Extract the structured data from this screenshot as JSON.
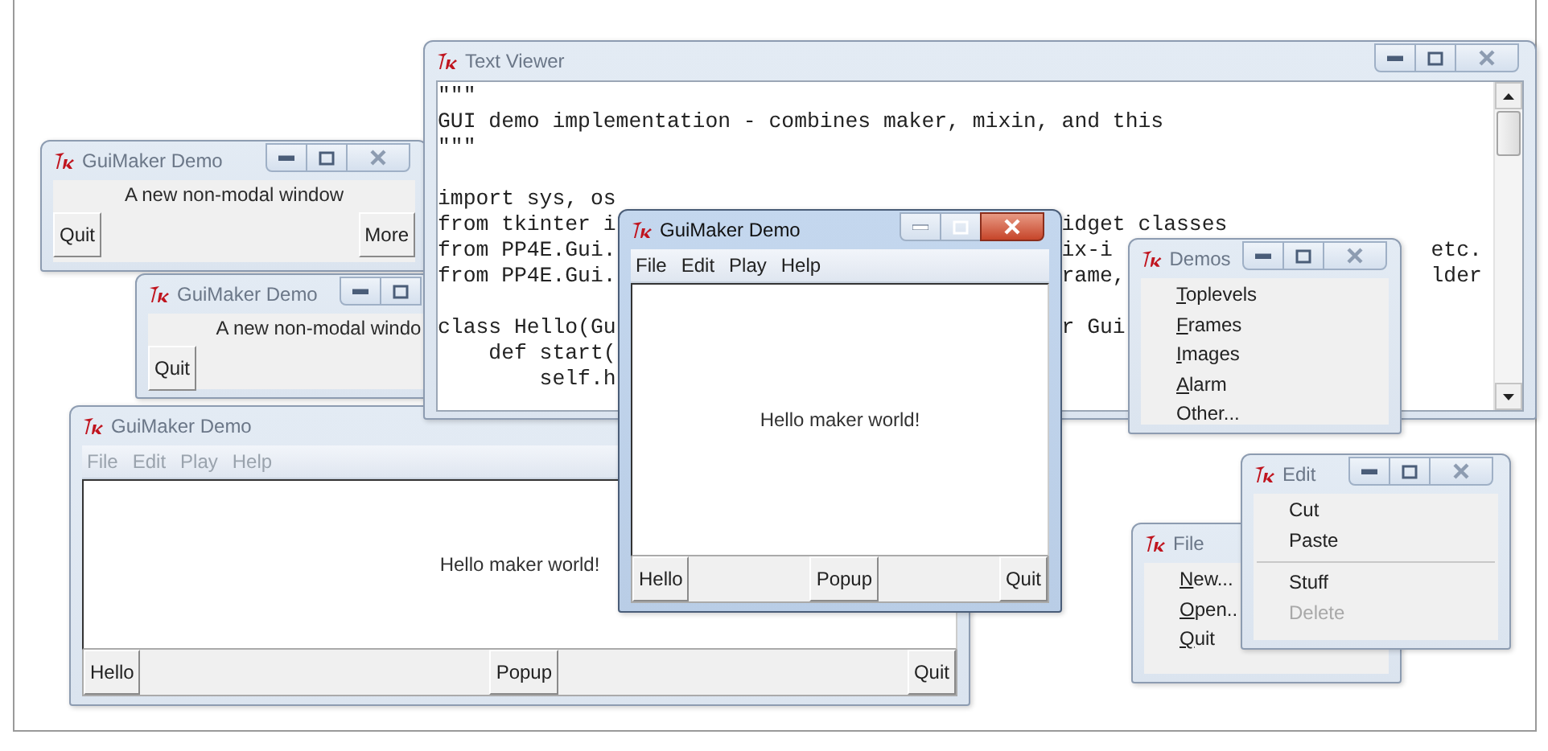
{
  "windows": [
    {
      "kind": "popup",
      "title": "GuiMaker Demo",
      "active": false,
      "title_buttons": [
        {
          "kind": "minimize"
        },
        {
          "kind": "maximize"
        },
        {
          "kind": "close"
        }
      ],
      "message": "A new non-modal window",
      "buttons": [
        "Quit",
        "More"
      ]
    },
    {
      "kind": "popup",
      "title": "GuiMaker Demo",
      "active": false,
      "title_buttons": [
        {
          "kind": "minimize"
        },
        {
          "kind": "maximize"
        }
      ],
      "message": "A new non-modal windo",
      "buttons": [
        "Quit"
      ]
    },
    {
      "kind": "demo",
      "title": "GuiMaker Demo",
      "active": false,
      "menu": [
        "File",
        "Edit",
        "Play",
        "Help"
      ],
      "message": "Hello maker world!",
      "buttons": [
        "Hello",
        "Popup",
        "Quit"
      ]
    },
    {
      "kind": "text_viewer",
      "title": "Text Viewer",
      "active": false,
      "title_buttons": [
        {
          "kind": "minimize"
        },
        {
          "kind": "maximize"
        },
        {
          "kind": "close"
        }
      ],
      "blocks": [
        [
          [
            "\"\"\""
          ],
          [
            "GUI demo implementation - combines maker, mixin, and this"
          ],
          [
            "\"\"\""
          ]
        ],
        [
          [
            "import sys, os"
          ],
          [
            "from tkinter i",
            "idget classes"
          ],
          [
            "from PP4E.Gui.",
            "ix-i",
            "etc."
          ],
          [
            "from PP4E.Gui.",
            "rame,",
            "lder"
          ]
        ],
        [
          [
            "class Hello(Gu",
            "r Gui"
          ],
          [
            "    def start("
          ],
          [
            "        self.h"
          ]
        ]
      ]
    },
    {
      "kind": "demo",
      "title": "GuiMaker Demo",
      "active": true,
      "title_buttons": [
        {
          "kind": "minimize"
        },
        {
          "kind": "maximize"
        },
        {
          "kind": "close"
        }
      ],
      "menu": [
        "File",
        "Edit",
        "Play",
        "Help"
      ],
      "message": "Hello maker world!",
      "buttons": [
        "Hello",
        "Popup",
        "Quit"
      ]
    },
    {
      "kind": "menu",
      "title": "Demos",
      "active": false,
      "title_buttons": [
        {
          "kind": "minimize"
        },
        {
          "kind": "maximize"
        },
        {
          "kind": "close"
        }
      ],
      "items": [
        {
          "kind": "item",
          "label": "Toplevels",
          "mnemonic": true,
          "disabled": false
        },
        {
          "kind": "item",
          "label": "Frames",
          "mnemonic": true,
          "disabled": false
        },
        {
          "kind": "item",
          "label": "Images",
          "mnemonic": true,
          "disabled": false
        },
        {
          "kind": "item",
          "label": "Alarm",
          "mnemonic": true,
          "disabled": false
        },
        {
          "kind": "item",
          "label": "Other...",
          "mnemonic": false,
          "disabled": false
        }
      ]
    },
    {
      "kind": "menu",
      "title": "File",
      "active": false,
      "items": [
        {
          "kind": "item",
          "label": "New...",
          "mnemonic": true,
          "disabled": false
        },
        {
          "kind": "item",
          "label": "Open..",
          "mnemonic": true,
          "disabled": false
        },
        {
          "kind": "item",
          "label": "Quit",
          "mnemonic": true,
          "disabled": false
        }
      ]
    },
    {
      "kind": "menu",
      "title": "Edit",
      "active": false,
      "title_buttons": [
        {
          "kind": "minimize"
        },
        {
          "kind": "maximize"
        },
        {
          "kind": "close"
        }
      ],
      "items": [
        {
          "kind": "item",
          "label": "Cut",
          "mnemonic": false,
          "disabled": false
        },
        {
          "kind": "item",
          "label": "Paste",
          "mnemonic": false,
          "disabled": false
        },
        {
          "kind": "separator"
        },
        {
          "kind": "item",
          "label": "Stuff",
          "mnemonic": false,
          "disabled": false
        },
        {
          "kind": "item",
          "label": "Delete",
          "mnemonic": false,
          "disabled": true
        }
      ]
    }
  ]
}
